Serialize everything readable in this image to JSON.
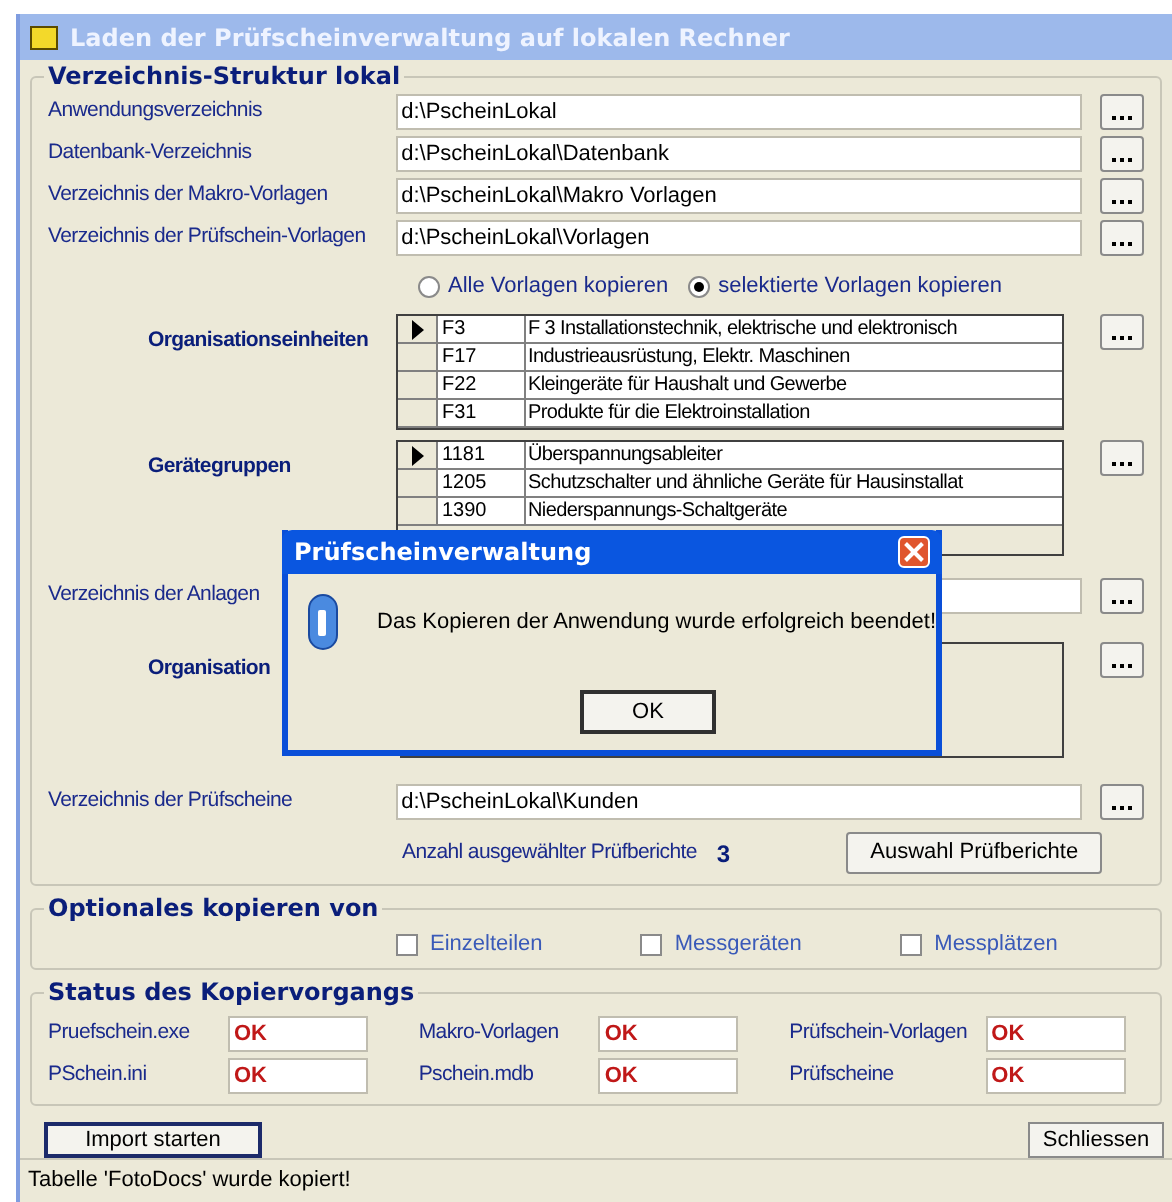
{
  "window": {
    "title": "Laden der Prüfscheinverwaltung auf lokalen Rechner"
  },
  "directories": {
    "title": "Verzeichnis-Struktur lokal",
    "fields": [
      {
        "label": "Anwendungsverzeichnis",
        "value": "d:\\PscheinLokal"
      },
      {
        "label": "Datenbank-Verzeichnis",
        "value": "d:\\PscheinLokal\\Datenbank"
      },
      {
        "label": "Verzeichnis der Makro-Vorlagen",
        "value": "d:\\PscheinLokal\\Makro Vorlagen"
      },
      {
        "label": "Verzeichnis der Prüfschein-Vorlagen",
        "value": "d:\\PscheinLokal\\Vorlagen"
      }
    ],
    "radios": [
      {
        "label": "Alle Vorlagen kopieren",
        "selected": false
      },
      {
        "label": "selektierte Vorlagen kopieren",
        "selected": true
      }
    ],
    "org_units": {
      "label": "Organisationseinheiten",
      "rows": [
        {
          "code": "F3",
          "name": "F 3 Installationstechnik, elektrische und elektronisch",
          "selected": true
        },
        {
          "code": "F17",
          "name": "Industrieausrüstung, Elektr. Maschinen",
          "selected": false
        },
        {
          "code": "F22",
          "name": "Kleingeräte für Haushalt und Gewerbe",
          "selected": false
        },
        {
          "code": "F31",
          "name": "Produkte für die Elektroinstallation",
          "selected": false
        }
      ]
    },
    "device_groups": {
      "label": "Gerätegruppen",
      "rows": [
        {
          "code": "1181",
          "name": "Überspannungsableiter",
          "selected": true
        },
        {
          "code": "1205",
          "name": "Schutzschalter und ähnliche Geräte für Hausinstallat",
          "selected": false
        },
        {
          "code": "1390",
          "name": "Niederspannungs-Schaltgeräte",
          "selected": false
        }
      ]
    },
    "plants": {
      "label": "Verzeichnis der Anlagen"
    },
    "org_units_2": {
      "label": "Organisation"
    },
    "reports": {
      "label": "Verzeichnis der Prüfscheine",
      "value": "d:\\PscheinLokal\\Kunden"
    },
    "count_label": "Anzahl ausgewählter Prüfberichte",
    "count": "3",
    "select_button": "Auswahl Prüfberichte"
  },
  "optional": {
    "title": "Optionales kopieren von",
    "checkboxes": [
      {
        "label": "Einzelteilen",
        "checked": false
      },
      {
        "label": "Messgeräten",
        "checked": false
      },
      {
        "label": "Messplätzen",
        "checked": false
      }
    ]
  },
  "status": {
    "title": "Status des Kopiervorgangs",
    "items": [
      {
        "label": "Pruefschein.exe",
        "value": "OK"
      },
      {
        "label": "Makro-Vorlagen",
        "value": "OK"
      },
      {
        "label": "Prüfschein-Vorlagen",
        "value": "OK"
      },
      {
        "label": "PSchein.ini",
        "value": "OK"
      },
      {
        "label": "Pschein.mdb",
        "value": "OK"
      },
      {
        "label": "Prüfscheine",
        "value": "OK"
      }
    ]
  },
  "buttons": {
    "start": "Import starten",
    "close": "Schliessen"
  },
  "status_bar": "Tabelle 'FotoDocs' wurde kopiert!",
  "dialog": {
    "title": "Prüfscheinverwaltung",
    "message": "Das Kopieren der Anwendung wurde erfolgreich beendet!",
    "button": "OK"
  }
}
